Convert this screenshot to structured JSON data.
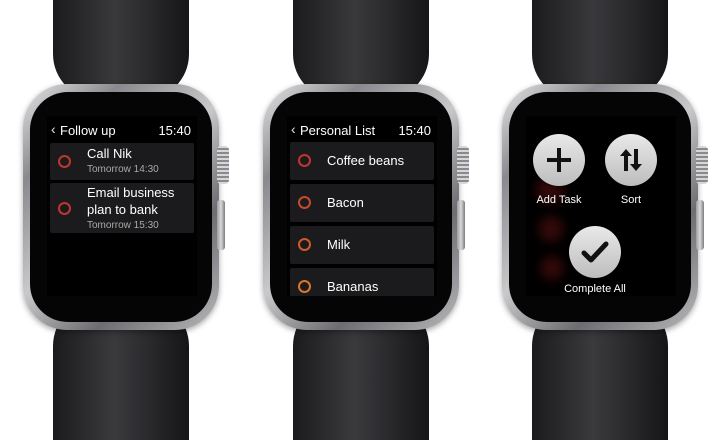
{
  "watch1": {
    "title": "Follow up",
    "time": "15:40",
    "tasks": [
      {
        "title": "Call Nik",
        "due": "Tomorrow 14:30"
      },
      {
        "title_line1": "Email business",
        "title_line2": "plan to bank",
        "due": "Tomorrow 15:30"
      }
    ]
  },
  "watch2": {
    "title": "Personal List",
    "time": "15:40",
    "items": [
      {
        "label": "Coffee beans",
        "color": "#c0352f"
      },
      {
        "label": "Bacon",
        "color": "#c44a2e"
      },
      {
        "label": "Milk",
        "color": "#cf5a2a"
      },
      {
        "label": "Bananas",
        "color": "#d8762b"
      }
    ]
  },
  "watch3": {
    "actions": [
      {
        "label": "Add Task",
        "icon": "plus-icon"
      },
      {
        "label": "Sort",
        "icon": "sort-arrows-icon"
      },
      {
        "label": "Complete All",
        "icon": "checkmark-icon"
      }
    ]
  },
  "colors": {
    "task_circle_red": "#c0352f",
    "row_background": "#1b1b1d",
    "button_grey": "#d6d6d7"
  }
}
